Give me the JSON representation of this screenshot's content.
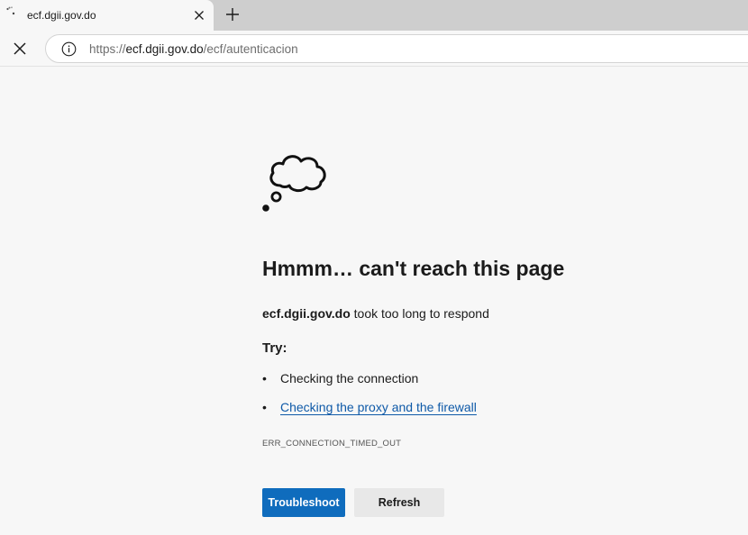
{
  "tab": {
    "title": "ecf.dgii.gov.do",
    "spinner_icon": "loading-spinner-icon",
    "close_icon": "close-icon"
  },
  "new_tab_icon": "plus-icon",
  "toolbar": {
    "stop_icon": "close-icon",
    "site_info_icon": "info-icon",
    "url": {
      "scheme": "https://",
      "host": "ecf.dgii.gov.do",
      "path": "/ecf/autenticacion"
    }
  },
  "error": {
    "icon": "thought-cloud-icon",
    "heading": "Hmmm… can't reach this page",
    "host": "ecf.dgii.gov.do",
    "message": " took too long to respond",
    "try_label": "Try:",
    "suggestions": [
      {
        "bullet": "•",
        "text": "Checking the connection"
      },
      {
        "bullet": "•",
        "text": "Checking the proxy and the firewall"
      }
    ],
    "code": "ERR_CONNECTION_TIMED_OUT",
    "primary_button": "Troubleshoot",
    "secondary_button": "Refresh"
  },
  "colors": {
    "accent": "#0f6cbd",
    "link": "#0f5aa8",
    "page_background": "#f7f7f7",
    "tabstrip": "#cecece"
  }
}
